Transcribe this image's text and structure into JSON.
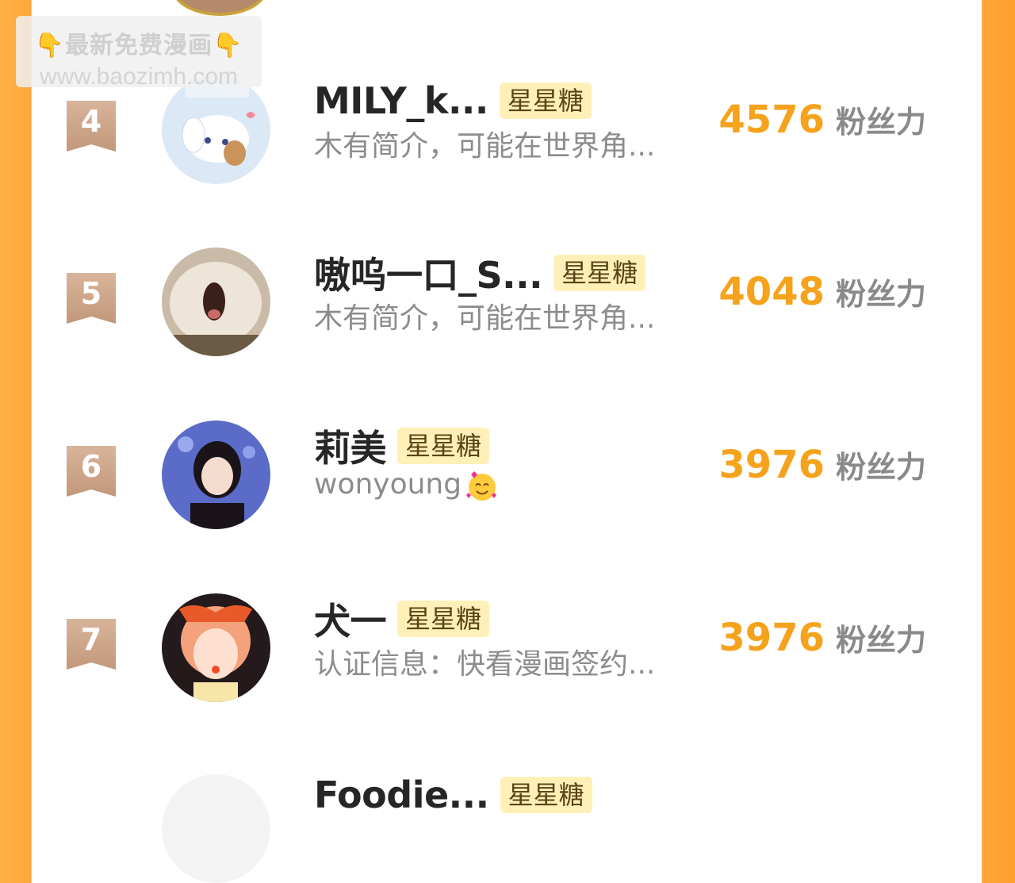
{
  "watermark": {
    "line1": "👇最新免费漫画👇",
    "line2": "www.baozimh.com"
  },
  "rows": [
    {
      "rank": "4",
      "name": "MILY_k...",
      "tag": "星星糖",
      "bio": "木有简介，可能在世界角...",
      "score": "4576",
      "unit": "粉丝力"
    },
    {
      "rank": "5",
      "name": "嗷呜一口_S...",
      "tag": "星星糖",
      "bio": "木有简介，可能在世界角...",
      "score": "4048",
      "unit": "粉丝力"
    },
    {
      "rank": "6",
      "name": "莉美",
      "tag": "星星糖",
      "bio": "wonyoung",
      "bio_emoji": "smiling-face-with-hearts-icon",
      "score": "3976",
      "unit": "粉丝力"
    },
    {
      "rank": "7",
      "name": "犬一",
      "tag": "星星糖",
      "bio": "认证信息：快看漫画签约...",
      "score": "3976",
      "unit": "粉丝力"
    },
    {
      "name": "Foodie...",
      "tag": "星星糖"
    }
  ],
  "colors": {
    "accent": "#f5a21c",
    "tag_bg": "#fff0b8",
    "side_orange": "#ffa63a"
  }
}
